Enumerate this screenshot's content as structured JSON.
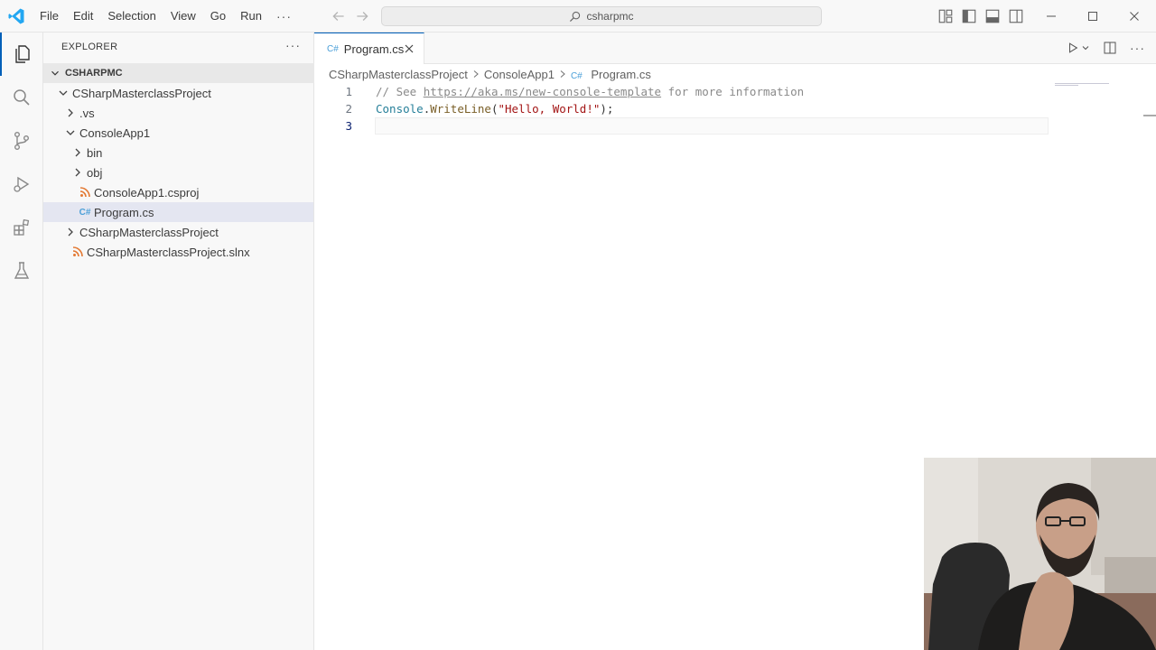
{
  "menu": [
    "File",
    "Edit",
    "Selection",
    "View",
    "Go",
    "Run"
  ],
  "menu_more": "···",
  "command_center": {
    "text": "csharpmc"
  },
  "sidebar": {
    "title": "EXPLORER",
    "more": "···",
    "section": "CSHARPMC",
    "tree": [
      {
        "label": "CSharpMasterclassProject",
        "indent": 1,
        "type": "folder-open"
      },
      {
        "label": ".vs",
        "indent": 2,
        "type": "folder"
      },
      {
        "label": "ConsoleApp1",
        "indent": 2,
        "type": "folder-open"
      },
      {
        "label": "bin",
        "indent": 3,
        "type": "folder"
      },
      {
        "label": "obj",
        "indent": 3,
        "type": "folder"
      },
      {
        "label": "ConsoleApp1.csproj",
        "indent": 3,
        "type": "rss"
      },
      {
        "label": "Program.cs",
        "indent": 3,
        "type": "cs",
        "selected": true
      },
      {
        "label": "CSharpMasterclassProject",
        "indent": 2,
        "type": "folder"
      },
      {
        "label": "CSharpMasterclassProject.slnx",
        "indent": 2,
        "type": "rss"
      }
    ]
  },
  "tab": {
    "label": "Program.cs",
    "icon": "C#"
  },
  "breadcrumb": [
    "CSharpMasterclassProject",
    "ConsoleApp1",
    "Program.cs"
  ],
  "editor": {
    "lines": [
      {
        "num": "1",
        "tokens": [
          {
            "t": "// See ",
            "c": "comment"
          },
          {
            "t": "https://aka.ms/new-console-template",
            "c": "link"
          },
          {
            "t": " for more information",
            "c": "comment"
          }
        ]
      },
      {
        "num": "2",
        "tokens": [
          {
            "t": "Console",
            "c": "type"
          },
          {
            "t": ".",
            "c": "plain"
          },
          {
            "t": "WriteLine",
            "c": "method"
          },
          {
            "t": "(",
            "c": "plain"
          },
          {
            "t": "\"Hello, World!\"",
            "c": "string"
          },
          {
            "t": ");",
            "c": "plain"
          }
        ]
      },
      {
        "num": "3",
        "tokens": []
      }
    ]
  },
  "colors": {
    "accent": "#005fb8",
    "vscode_blue": "#23a7f2"
  },
  "icons": [
    "vscode-logo-icon",
    "arrow-left-icon",
    "arrow-right-icon",
    "search-icon",
    "toggle-primary-sidebar-icon",
    "toggle-panel-icon",
    "toggle-secondary-sidebar-icon",
    "customize-layout-icon",
    "minimize-icon",
    "maximize-icon",
    "close-icon",
    "explorer-files-icon",
    "search-icon",
    "source-control-icon",
    "run-debug-icon",
    "extensions-icon",
    "testing-icon",
    "run-icon",
    "split-editor-icon"
  ]
}
